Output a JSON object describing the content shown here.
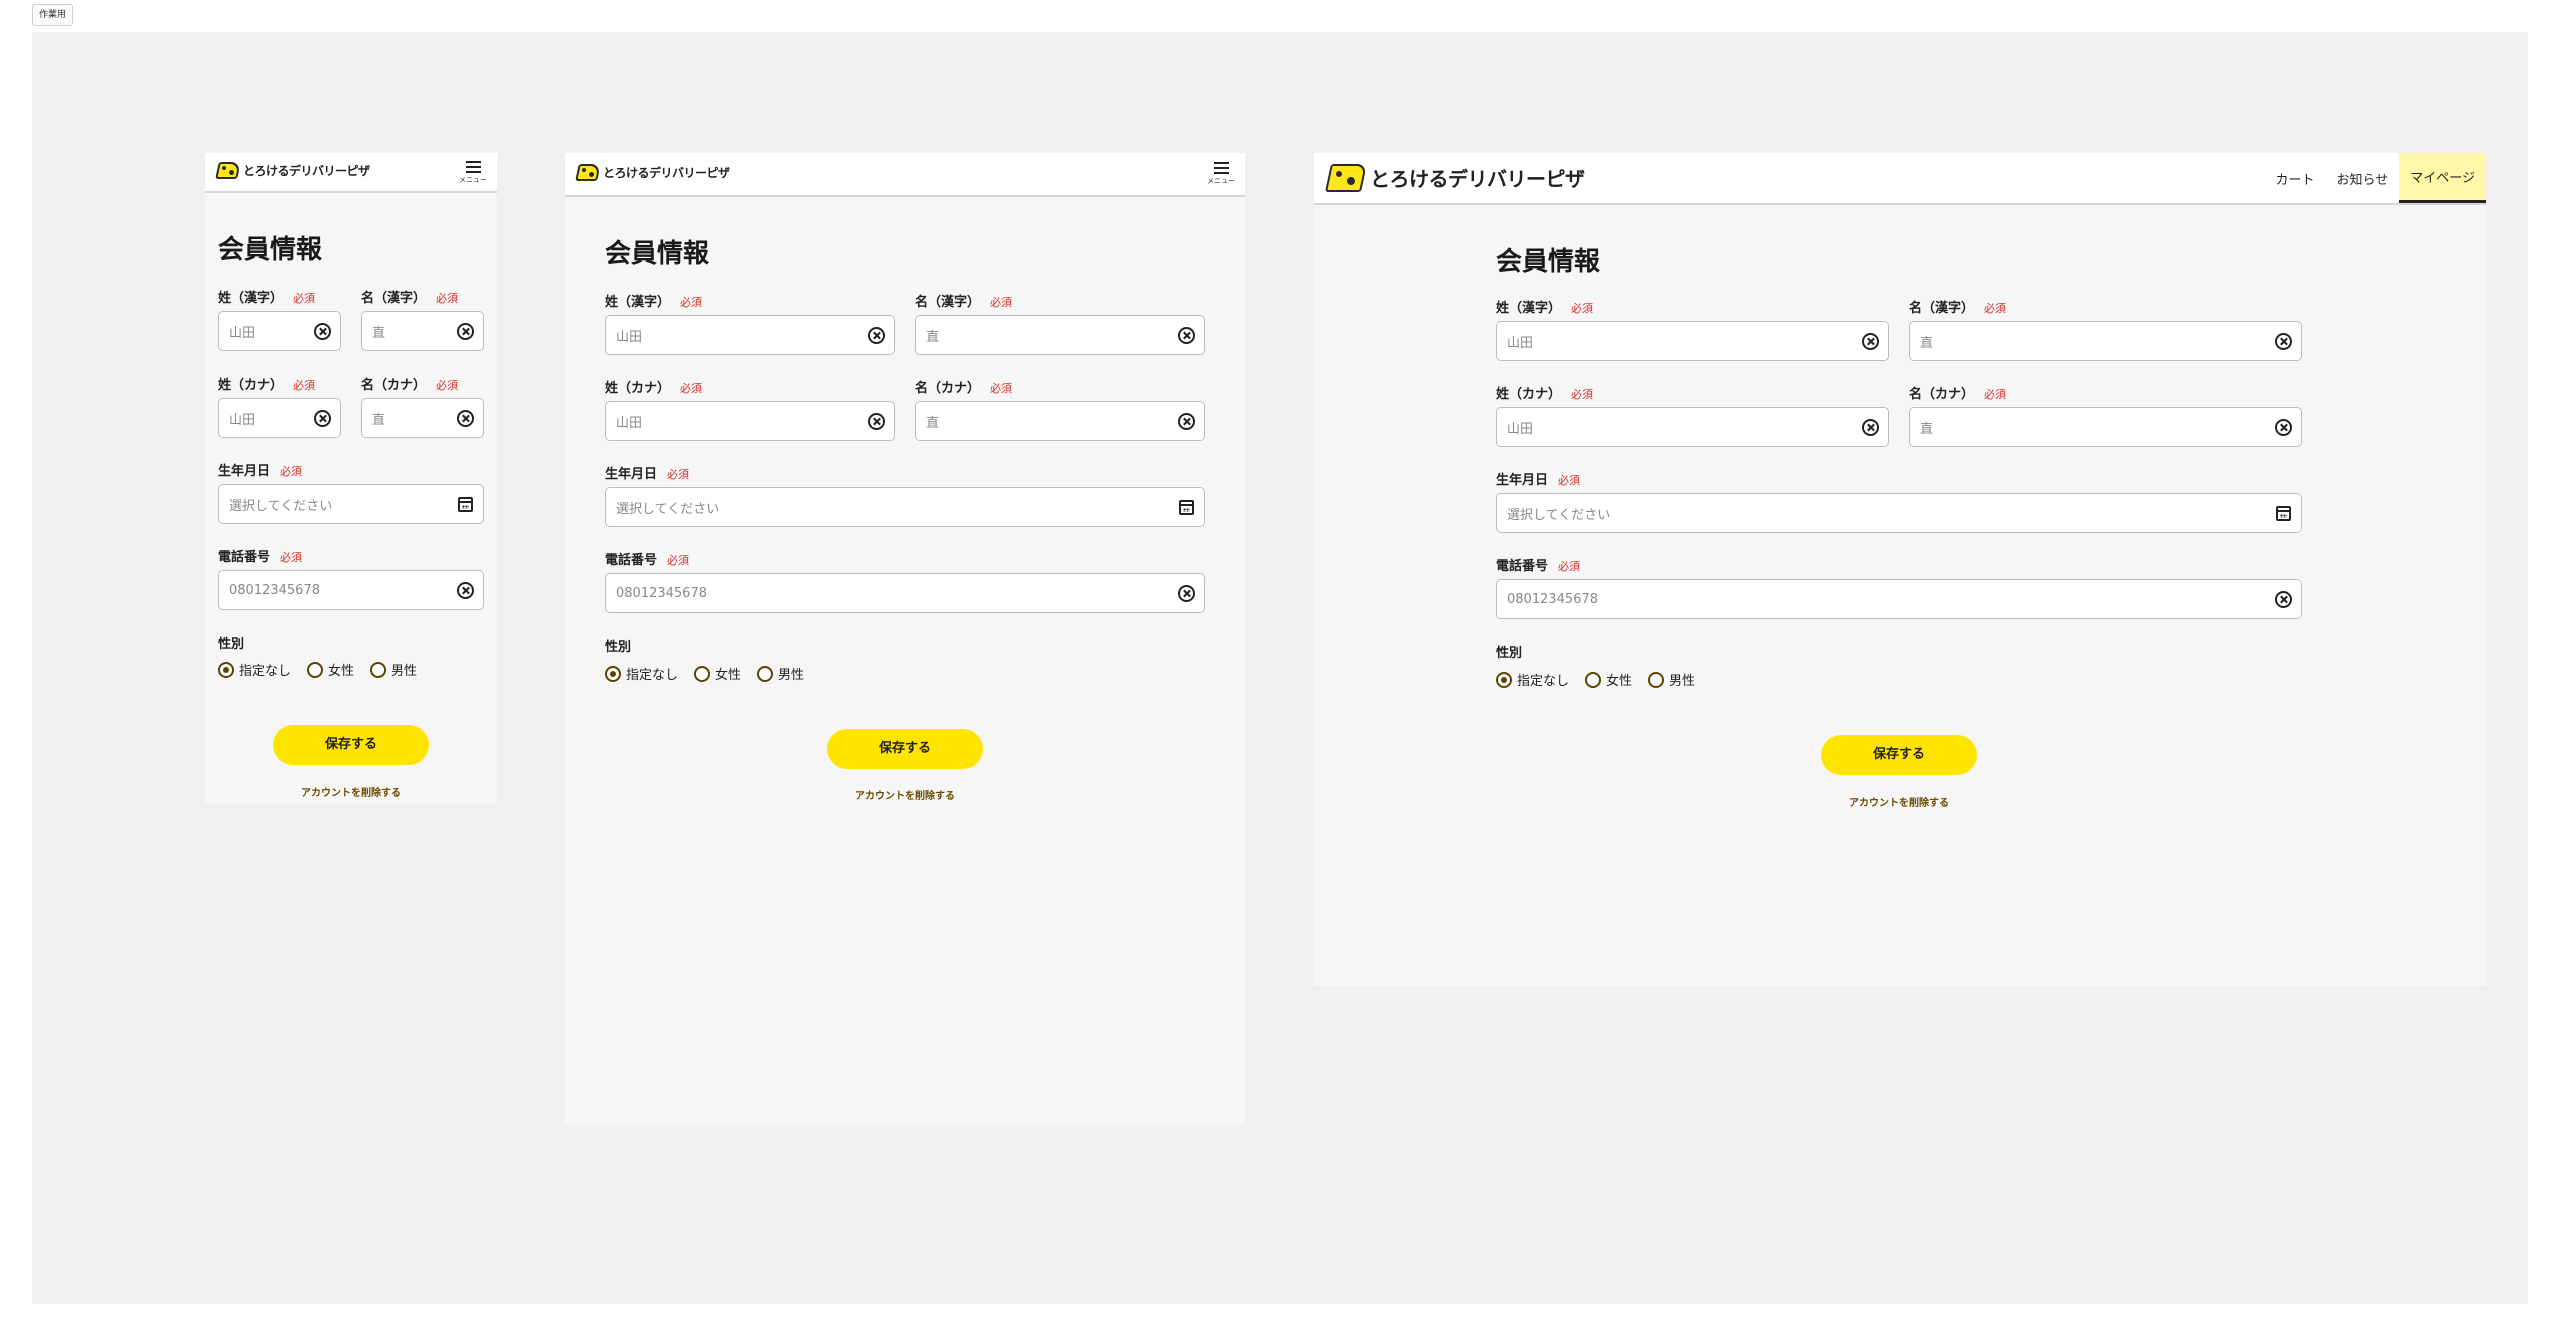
{
  "toolbar": {
    "work_label": "作業用"
  },
  "brand": {
    "name": "とろけるデリバリーピザ",
    "accent": "#ffe400",
    "required_color": "#d0302a"
  },
  "header": {
    "menu_label": "メニュー"
  },
  "nav": {
    "items": [
      {
        "label": "カート"
      },
      {
        "label": "お知らせ"
      },
      {
        "label": "マイページ",
        "active": true
      }
    ]
  },
  "form": {
    "title": "会員情報",
    "required": "必須",
    "last_name_kanji": {
      "label": "姓（漢字）",
      "value": "山田"
    },
    "first_name_kanji": {
      "label": "名（漢字）",
      "value": "直"
    },
    "last_name_kana": {
      "label": "姓（カナ）",
      "value": "山田"
    },
    "first_name_kana": {
      "label": "名（カナ）",
      "value": "直"
    },
    "birthday": {
      "label": "生年月日",
      "placeholder": "選択してください"
    },
    "phone": {
      "label": "電話番号",
      "value": "08012345678"
    },
    "gender": {
      "label": "性別",
      "options": [
        {
          "label": "指定なし",
          "checked": true
        },
        {
          "label": "女性",
          "checked": false
        },
        {
          "label": "男性",
          "checked": false
        }
      ]
    },
    "save_label": "保存する",
    "delete_label": "アカウントを削除する"
  }
}
